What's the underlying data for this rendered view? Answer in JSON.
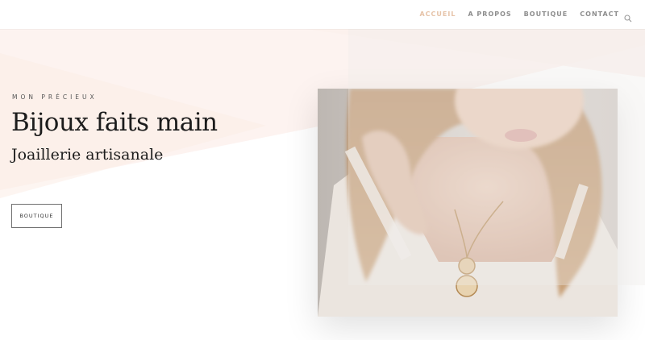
{
  "header": {
    "nav": [
      {
        "label": "ACCUEIL",
        "active": true
      },
      {
        "label": "A PROPOS",
        "active": false
      },
      {
        "label": "BOUTIQUE",
        "active": false
      },
      {
        "label": "CONTACT",
        "active": false
      }
    ],
    "search_icon": "search-icon"
  },
  "hero": {
    "eyebrow": "MON PRÉCIEUX",
    "title": "Bijoux faits main",
    "subtitle": "Joaillerie artisanale",
    "cta_label": "BOUTIQUE"
  },
  "colors": {
    "accent": "#e6c3a8",
    "nav_text": "#8e8e8e",
    "heading_text": "#1c1c1c",
    "hero_tint": "#fdf3f0"
  }
}
